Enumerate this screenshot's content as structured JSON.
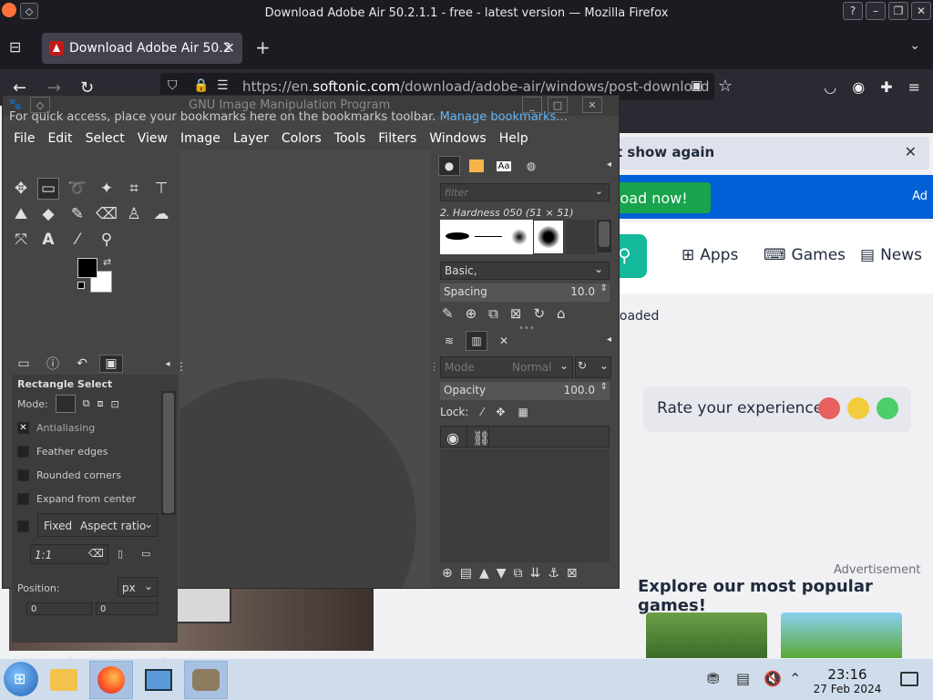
{
  "firefox": {
    "window_title": "Download Adobe Air 50.2.1.1 - free - latest version — Mozilla Firefox",
    "tab_title": "Download Adobe Air 50.2",
    "url_prefix": "https://en.",
    "url_domain": "softonic.com",
    "url_path": "/download/adobe-air/windows/post-download",
    "bookmarks_hint": "For quick access, place your bookmarks here on the bookmarks toolbar.",
    "manage_bookmarks": "Manage bookmarks..."
  },
  "webpage": {
    "notice_text": "t show again",
    "download_btn": "load now!",
    "ad_label": "Ad",
    "nav": [
      "Apps",
      "Games",
      "News"
    ],
    "downloaded_text": "loaded",
    "rate_label": "Rate your experience",
    "advertisement": "Advertisement",
    "popular_title": "Explore our most popular games!",
    "colors": {
      "blue_bar": "#0060d6",
      "download_green": "#19a34d",
      "search_teal": "#14b89a"
    }
  },
  "gimp": {
    "title": "GNU Image Manipulation Program",
    "menu": [
      "File",
      "Edit",
      "Select",
      "View",
      "Image",
      "Layer",
      "Colors",
      "Tools",
      "Filters",
      "Windows",
      "Help"
    ],
    "tool_options": {
      "heading": "Rectangle Select",
      "mode_label": "Mode:",
      "antialiasing": "Antialiasing",
      "feather": "Feather edges",
      "rounded": "Rounded corners",
      "expand": "Expand from center",
      "fixed": "Fixed",
      "aspect": "Aspect ratio",
      "ratio_value": "1:1",
      "position_label": "Position:",
      "unit": "px",
      "pos_x": "0",
      "pos_y": "0"
    },
    "brushes": {
      "filter_placeholder": "filter",
      "brush_name": "2. Hardness 050 (51 × 51)",
      "preset": "Basic,",
      "spacing_label": "Spacing",
      "spacing_value": "10.0"
    },
    "layers": {
      "mode_label": "Mode",
      "mode_value": "Normal",
      "opacity_label": "Opacity",
      "opacity_value": "100.0",
      "lock_label": "Lock:"
    }
  },
  "taskbar": {
    "time": "23:16",
    "date": "27 Feb 2024"
  }
}
